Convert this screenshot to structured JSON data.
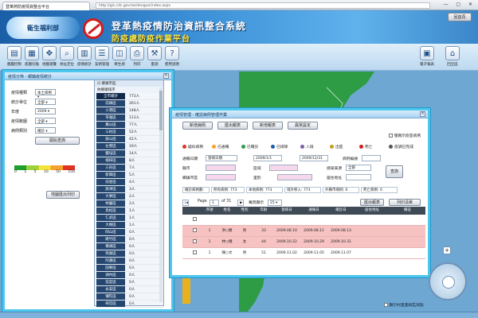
{
  "browser": {
    "tab_title": "登革熱防疫情資整合平台",
    "address": "http://gis.cdc.gov.tw/dengue/index.aspx",
    "window_controls": "— ▢ ✕"
  },
  "header": {
    "logo_text": "衛生福利部",
    "title_main": "登革熱疫情防治資訊整合系統",
    "title_sub": "防疫處防疫作業平台",
    "exit_label": "回首頁"
  },
  "toolbar": {
    "tools": [
      {
        "icon": "folder-icon",
        "glyph": "▤",
        "label": "圖層控制"
      },
      {
        "icon": "map-icon",
        "glyph": "▦",
        "label": "底圖切換"
      },
      {
        "icon": "pan-icon",
        "glyph": "✥",
        "label": "地圖瀏覽"
      },
      {
        "icon": "search-icon",
        "glyph": "⌕",
        "label": "地址定位"
      },
      {
        "icon": "chart-icon",
        "glyph": "▥",
        "label": "疫情統計"
      },
      {
        "icon": "list-icon",
        "glyph": "☰",
        "label": "案例管理"
      },
      {
        "icon": "layers-icon",
        "glyph": "◫",
        "label": "孳生源"
      },
      {
        "icon": "print-icon",
        "glyph": "⎙",
        "label": "列印"
      },
      {
        "icon": "tool-icon",
        "glyph": "⚒",
        "label": "量測"
      },
      {
        "icon": "help-icon",
        "glyph": "?",
        "label": "使用說明"
      }
    ],
    "right_tools": [
      {
        "icon": "report-icon",
        "glyph": "▣",
        "label": "電子報表"
      },
      {
        "icon": "home-icon",
        "glyph": "⌂",
        "label": "回全區"
      }
    ]
  },
  "left_panel": {
    "title": "疫情分佈 - 鄉鎮疫情統計",
    "filters": [
      {
        "label": "疫情種類",
        "value": "本土病例"
      },
      {
        "label": "統計單位",
        "value": "全部"
      },
      {
        "label": "年度",
        "value": "2009"
      },
      {
        "label": "疫情範圍",
        "value": "全部"
      },
      {
        "label": "病例類別",
        "value": "確診"
      }
    ],
    "query_button": "開始查詢",
    "legend_values": [
      "0",
      "1",
      "5",
      "10",
      "50",
      "150"
    ],
    "export_button": "地圖匯出列印",
    "town_list": {
      "header": "☑ 鄉鎮市區",
      "tab": "依鄉鎮排序",
      "rows": [
        {
          "name": "全市總計",
          "value": "773人"
        },
        {
          "name": "前鎮區",
          "value": "261人"
        },
        {
          "name": "小港區",
          "value": "148人"
        },
        {
          "name": "苓雅區",
          "value": "113人"
        },
        {
          "name": "鳳山區",
          "value": "77人"
        },
        {
          "name": "三民區",
          "value": "52人"
        },
        {
          "name": "鼓山區",
          "value": "42人"
        },
        {
          "name": "左營區",
          "value": "19人"
        },
        {
          "name": "鹽埕區",
          "value": "14人"
        },
        {
          "name": "楠梓區",
          "value": "8人"
        },
        {
          "name": "三民區",
          "value": "7人"
        },
        {
          "name": "新興區",
          "value": "5人"
        },
        {
          "name": "前金區",
          "value": "4人"
        },
        {
          "name": "旗津區",
          "value": "3人"
        },
        {
          "name": "大寮區",
          "value": "2人"
        },
        {
          "name": "林園區",
          "value": "2人"
        },
        {
          "name": "鳥松區",
          "value": "1人"
        },
        {
          "name": "仁武區",
          "value": "1人"
        },
        {
          "name": "大樹區",
          "value": "1人"
        },
        {
          "name": "岡山區",
          "value": "0人"
        },
        {
          "name": "路竹區",
          "value": "0人"
        },
        {
          "name": "橋頭區",
          "value": "0人"
        },
        {
          "name": "燕巢區",
          "value": "0人"
        },
        {
          "name": "阿蓮區",
          "value": "0人"
        },
        {
          "name": "田寮區",
          "value": "0人"
        },
        {
          "name": "湖內區",
          "value": "0人"
        },
        {
          "name": "茄萣區",
          "value": "0人"
        },
        {
          "name": "永安區",
          "value": "0人"
        },
        {
          "name": "彌陀區",
          "value": "0人"
        },
        {
          "name": "梓官區",
          "value": "0人"
        }
      ]
    }
  },
  "right_panel": {
    "title": "疫情管理 - 確認病例管理作業",
    "top_buttons": [
      "新增病例",
      "匯出報表",
      "新增報表",
      "異常設定"
    ],
    "show_all_label": "僅顯示疫區病例",
    "legend_items": [
      "疑似病例",
      "已通報",
      "已確診",
      "已排除",
      "入境",
      "出區",
      "死亡",
      "疫調已完成"
    ],
    "form": {
      "report_date_label": "通報日期",
      "report_date_type": "發病日期",
      "date_from": "2009/1/1",
      "date_to": "2009/12/31",
      "case_label": "病例編號",
      "county_label": "縣市",
      "district_label": "區域",
      "source_label": "感染來源",
      "source_value": "全部",
      "town_label": "鄉鎮市區",
      "village_label": "里別",
      "address_label": "居住地址",
      "search_button": "查詢"
    },
    "summary": [
      "確診病例數:",
      "所有病例: 773",
      "本地病例: 773",
      "境外移入: 773",
      "外縣市病例: 0",
      "死亡病例: 0"
    ],
    "pager": {
      "prefix": "Page",
      "page": "1",
      "of": "of 31",
      "per_label": "每頁顯示",
      "per": "25",
      "export": "匯出報表",
      "print": "列印清單"
    },
    "columns": [
      "",
      "",
      "序號",
      "姓名",
      "性別",
      "年齡",
      "發病日",
      "通報日",
      "確診日",
      "居住地址",
      "備註"
    ],
    "rows": [
      {
        "style": "white",
        "cells": [
          "",
          "",
          "",
          "",
          "",
          "",
          "",
          "",
          "",
          "",
          ""
        ]
      },
      {
        "style": "red",
        "cells": [
          "",
          "",
          "1",
          "洪○勝",
          "男",
          "33",
          "2009.08.10",
          "2009.08.11",
          "2009.08.13",
          "",
          ""
        ]
      },
      {
        "style": "red",
        "cells": [
          "",
          "",
          "1",
          "林○儀",
          "女",
          "44",
          "2009.10.22",
          "2009.10.29",
          "2009.10.31",
          "",
          ""
        ]
      },
      {
        "style": "white",
        "cells": [
          "",
          "",
          "1",
          "陳○文",
          "男",
          "51",
          "2009.11.02",
          "2009.11.05",
          "2009.11.07",
          "",
          ""
        ]
      }
    ]
  },
  "map": {
    "checkbox_label": "顯示村里圖與監測點",
    "zoom_in": "+"
  }
}
